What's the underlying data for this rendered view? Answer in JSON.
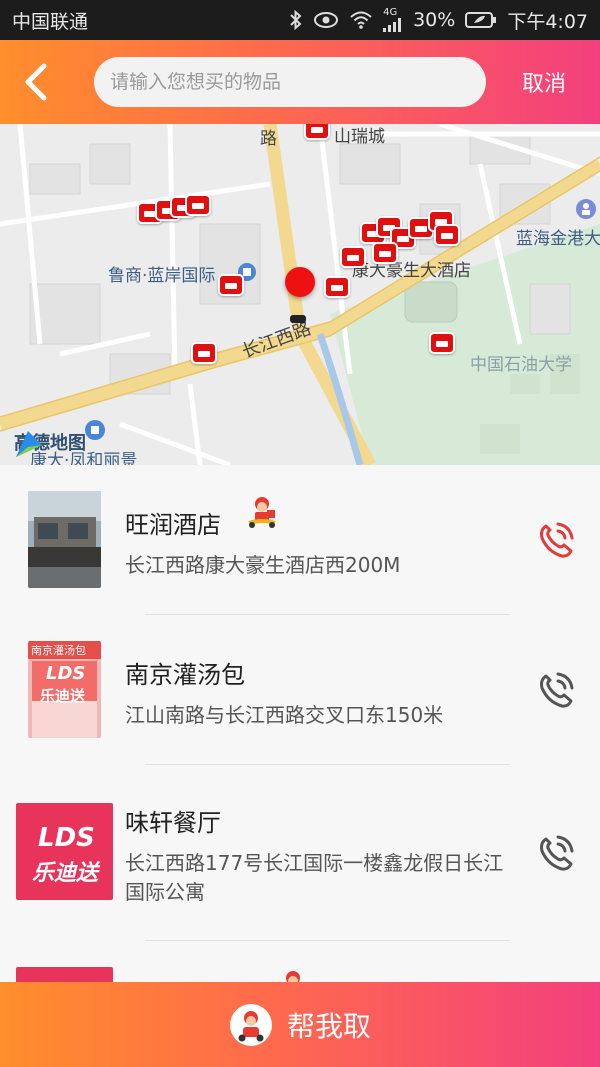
{
  "status": {
    "carrier": "中国联通",
    "network": "4G",
    "battery": "30%",
    "time": "下午4:07"
  },
  "header": {
    "search_placeholder": "请输入您想买的物品",
    "cancel_label": "取消"
  },
  "map": {
    "labels": {
      "shanruicheng": "山瑞城",
      "lu": "路",
      "lanhai": "蓝海金港大",
      "lushang": "鲁商·蓝岸国际",
      "kangda": "康大豪生大酒店",
      "changjiang": "长江西路",
      "shiyou": "中国石油大学",
      "fenghe": "康大·凤和丽景",
      "amap": "高德地图"
    }
  },
  "stores": [
    {
      "name": "旺润酒店",
      "address": "长江西路康大豪生酒店西200M",
      "delivery": true,
      "phone_active": true
    },
    {
      "name": "南京灌汤包",
      "address": "江山南路与长江西路交叉口东150米",
      "delivery": false,
      "phone_active": false
    },
    {
      "name": "味轩餐厅",
      "address": "长江西路177号长江国际一楼鑫龙假日长江国际公寓",
      "delivery": false,
      "phone_active": false
    }
  ],
  "thumbs": {
    "lds_text": "LDS",
    "lds_cn": "乐迪送",
    "nj_sign": "南京灌汤包"
  },
  "bottom": {
    "label": "帮我取"
  },
  "colors": {
    "gradient_start": "#ff8e2b",
    "gradient_end": "#f33f7e",
    "pin_red": "#e10f10",
    "phone_active": "#e33b3b",
    "phone_inactive": "#555555"
  }
}
